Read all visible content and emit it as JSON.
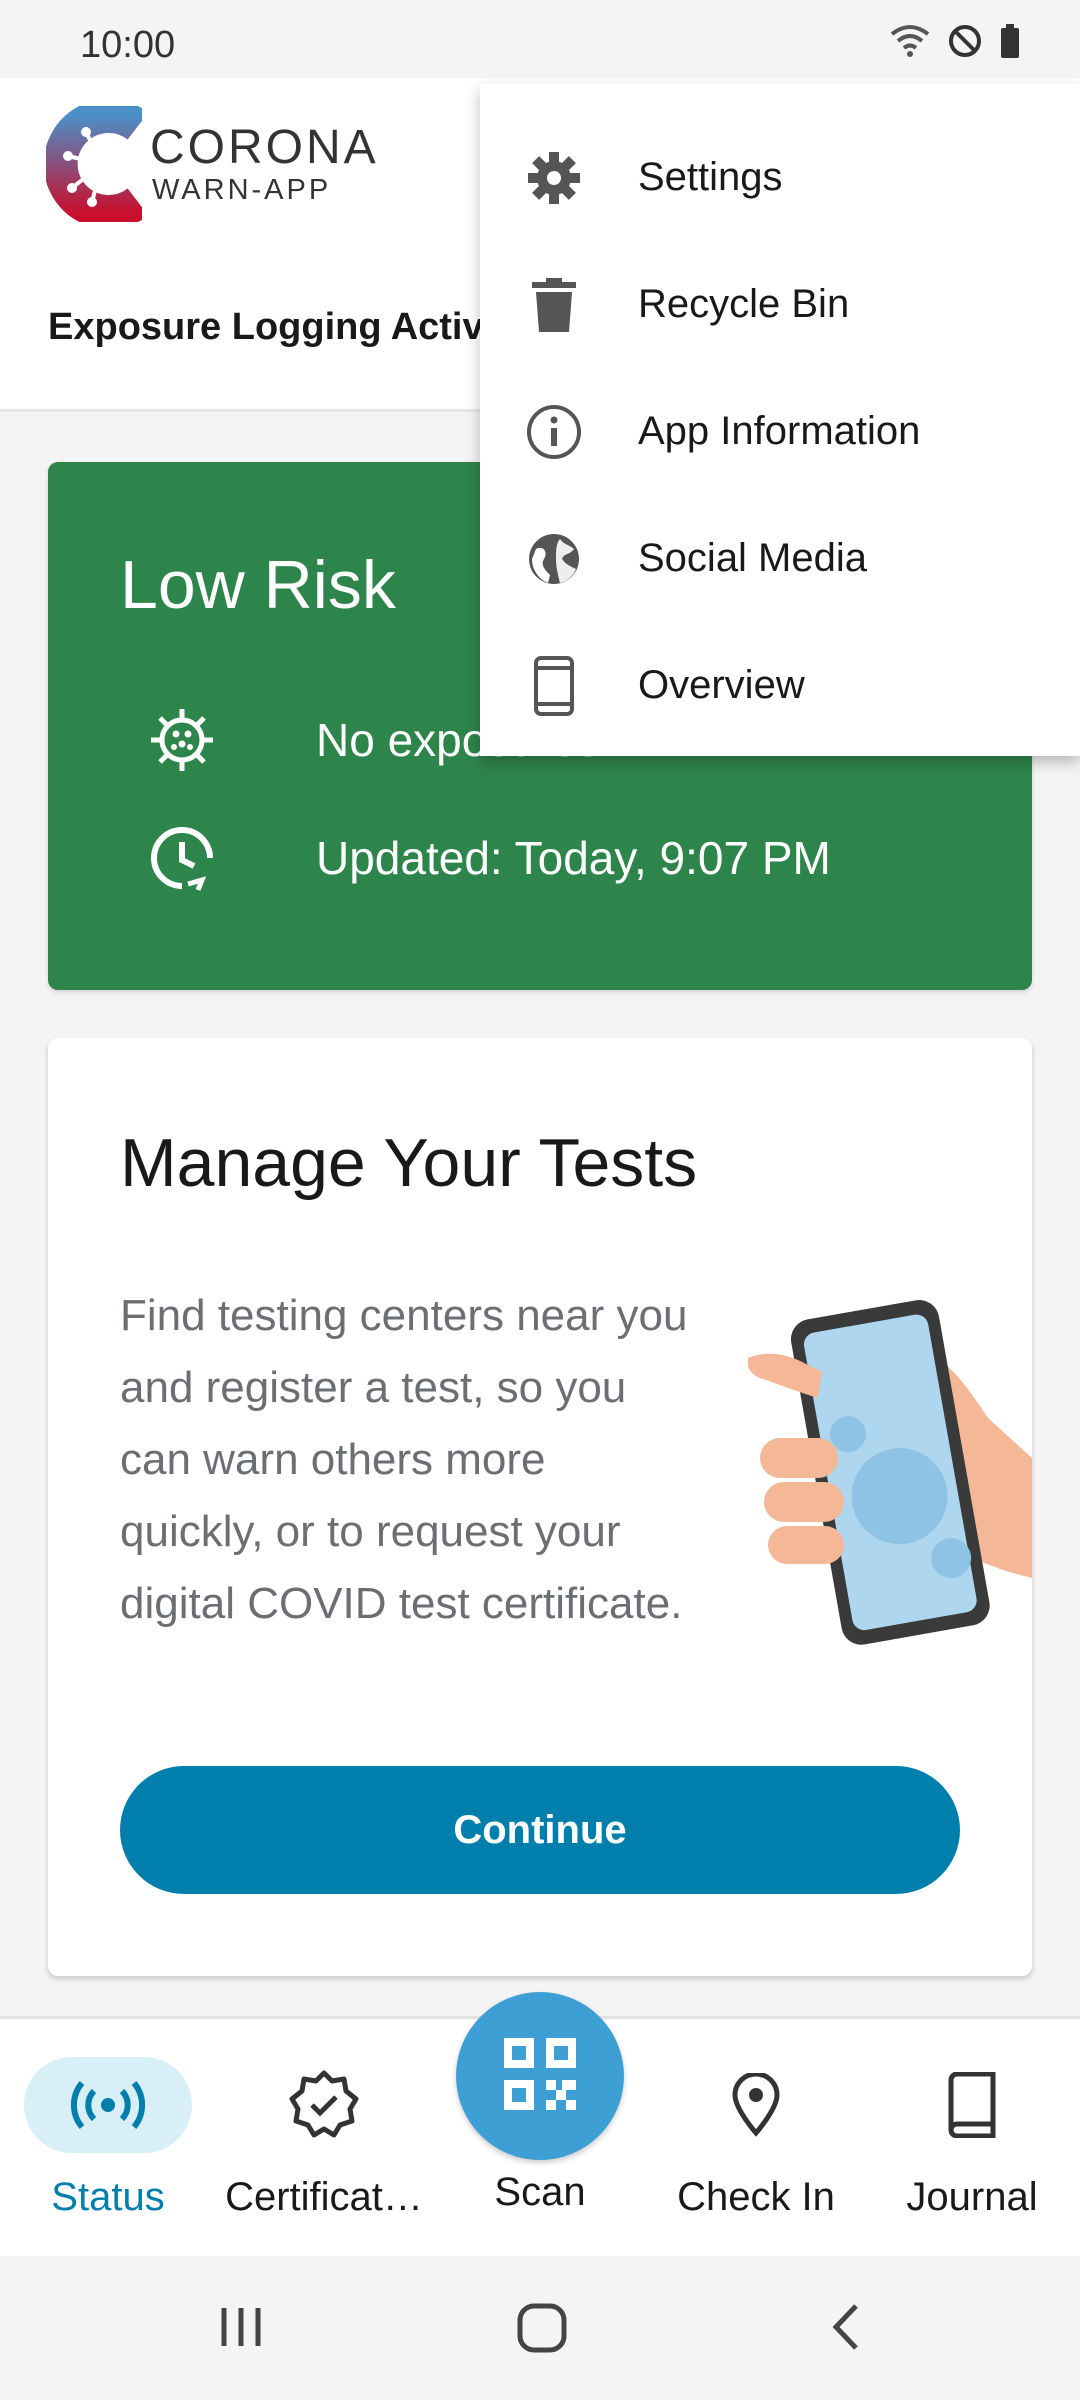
{
  "status_bar": {
    "time": "10:00"
  },
  "header": {
    "logo_line1": "CORONA",
    "logo_line2": "WARN-APP",
    "exposure_logging_label": "Exposure Logging Active"
  },
  "risk_card": {
    "title": "Low Risk",
    "exposure_text": "No exposures",
    "updated_text": "Updated: Today, 9:07 PM",
    "color": "#2e854b"
  },
  "tests_card": {
    "title": "Manage Your Tests",
    "body": "Find testing centers near you and register a test, so you can warn others more quickly, or to request your digital COVID test certificate.",
    "button_label": "Continue",
    "button_color": "#007fad"
  },
  "overflow_menu": {
    "items": [
      {
        "label": "Settings",
        "icon": "gear-icon"
      },
      {
        "label": "Recycle Bin",
        "icon": "trash-icon"
      },
      {
        "label": "App Information",
        "icon": "info-icon"
      },
      {
        "label": "Social Media",
        "icon": "globe-icon"
      },
      {
        "label": "Overview",
        "icon": "phone-icon"
      }
    ]
  },
  "bottom_nav": {
    "items": [
      {
        "label": "Status",
        "icon": "broadcast-icon",
        "active": true
      },
      {
        "label": "Certificat…",
        "icon": "certificate-icon",
        "active": false
      },
      {
        "label": "Scan",
        "icon": "qr-code-icon",
        "active": false
      },
      {
        "label": "Check In",
        "icon": "location-pin-icon",
        "active": false
      },
      {
        "label": "Journal",
        "icon": "book-icon",
        "active": false
      }
    ],
    "accent": "#007fad"
  }
}
